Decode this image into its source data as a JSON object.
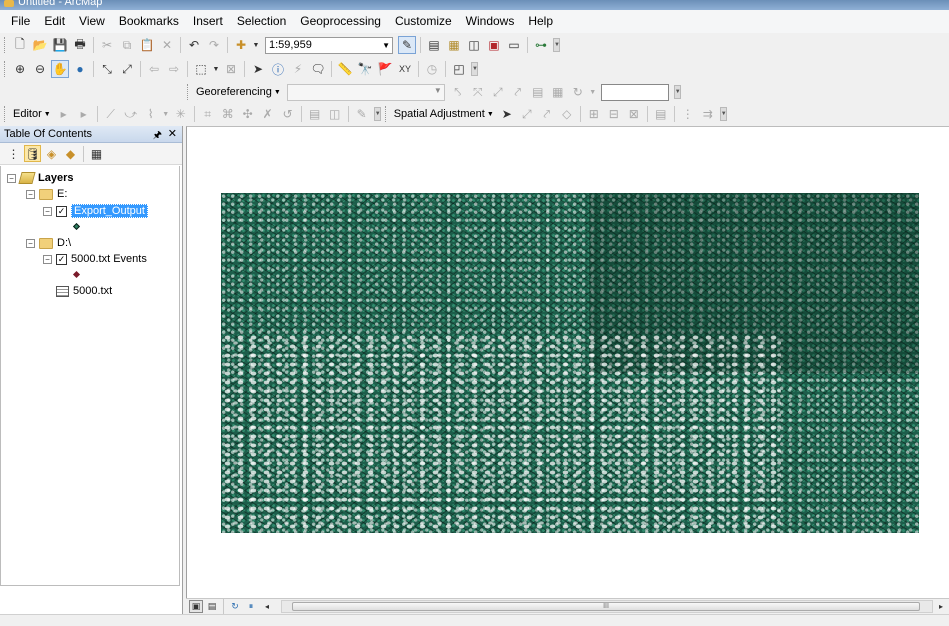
{
  "window": {
    "title": "Untitled - ArcMap"
  },
  "menu": [
    "File",
    "Edit",
    "View",
    "Bookmarks",
    "Insert",
    "Selection",
    "Geoprocessing",
    "Customize",
    "Windows",
    "Help"
  ],
  "standard_toolbar": {
    "scale": "1:59,959"
  },
  "georef_toolbar": {
    "label": "Georeferencing"
  },
  "editor_toolbar": {
    "editor_label": "Editor",
    "spatial_adjustment_label": "Spatial Adjustment"
  },
  "toc": {
    "title": "Table Of Contents",
    "root": "Layers",
    "groups": [
      {
        "name": "E:",
        "layers": [
          {
            "name": "Export_Output",
            "checked": true,
            "selected": true,
            "symbol_color": "#2e7d5f"
          }
        ]
      },
      {
        "name": "D:\\",
        "layers": [
          {
            "name": "5000.txt Events",
            "checked": true,
            "selected": false,
            "symbol_color": "#7a1b2b"
          }
        ],
        "tables": [
          {
            "name": "5000.txt"
          }
        ]
      }
    ]
  },
  "bottom": {
    "scroll_label": "III"
  },
  "colors": {
    "point_fill": "#2e8a6a",
    "point_outline": "#0a1f18",
    "selection": "#3399ff"
  }
}
